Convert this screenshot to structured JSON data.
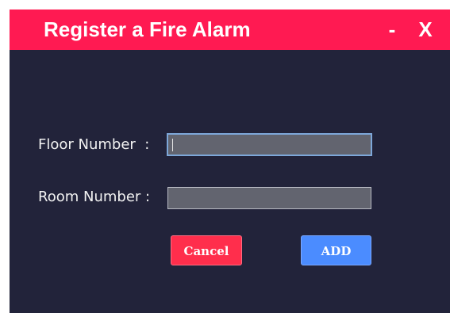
{
  "window": {
    "title": "Register a Fire Alarm",
    "minimize_label": "-",
    "close_label": "X"
  },
  "form": {
    "floor_label": "Floor Number  :",
    "floor_value": "",
    "room_label": "Room Number :",
    "room_value": ""
  },
  "buttons": {
    "cancel_label": "Cancel",
    "add_label": "ADD"
  },
  "colors": {
    "titlebar": "#ff1a52",
    "background": "#22233a",
    "field": "#62646f",
    "cancel": "#ff2e4c",
    "add": "#4b8cff"
  }
}
